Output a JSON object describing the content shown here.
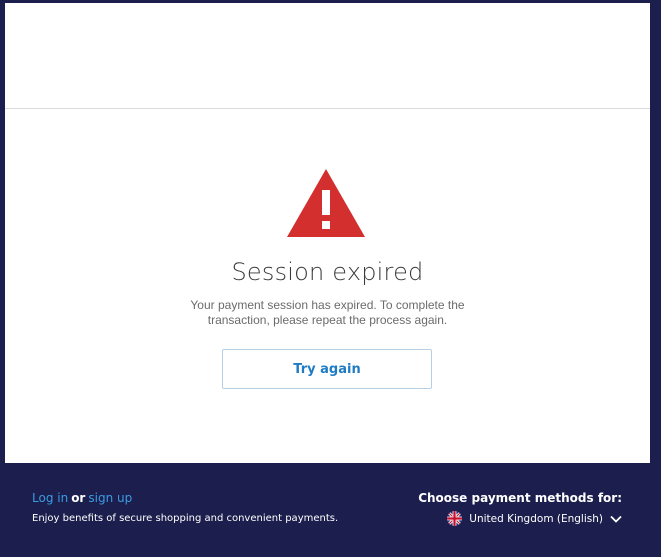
{
  "error": {
    "icon": "warning-triangle-icon",
    "icon_color": "#d32f2f",
    "title": "Session expired",
    "description": "Your payment session has expired. To complete the transaction, please repeat the process again."
  },
  "actions": {
    "try_again_label": "Try again"
  },
  "footer": {
    "login_label": "Log in",
    "or_label": "or",
    "signup_label": "sign up",
    "benefits": "Enjoy benefits of secure shopping and convenient payments.",
    "payment_methods_title": "Choose payment methods for:",
    "country_label": "United Kingdom (English)",
    "flag_icon": "uk-flag-icon",
    "dropdown_icon": "chevron-down-icon"
  },
  "colors": {
    "footer_bg": "#1c1f4d",
    "link": "#3a9be0",
    "button_text": "#1f7cc4"
  }
}
